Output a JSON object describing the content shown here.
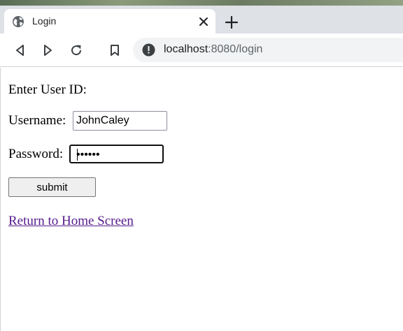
{
  "browser": {
    "tab": {
      "title": "Login",
      "icon": "globe-icon"
    },
    "new_tab_icon": "plus-icon",
    "toolbar_icons": [
      "back-icon",
      "forward-icon",
      "reload-icon",
      "bookmark-icon"
    ],
    "address": {
      "host": "localhost",
      "path": ":8080/login",
      "security_icon": "info-icon"
    }
  },
  "page": {
    "heading": "Enter User ID:",
    "username_label": "Username:",
    "username_value": "JohnCaley",
    "password_label": "Password:",
    "password_mask": "••••••",
    "submit_label": "submit",
    "home_link": "Return to Home Screen",
    "link_color": "#551a8b"
  }
}
